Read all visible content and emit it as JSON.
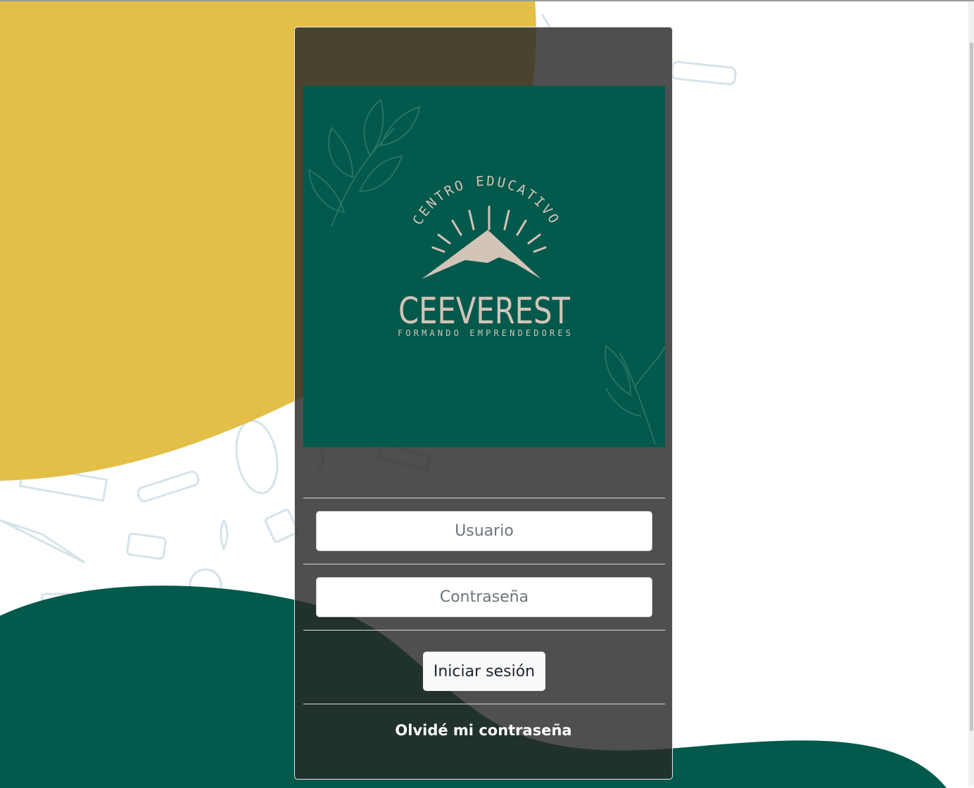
{
  "colors": {
    "yellow": "#e3bf48",
    "green": "#02594c",
    "logo_beige": "#d3c4b8",
    "panel": "#3c3c3c"
  },
  "logo": {
    "top_text": "CENTRO EDUCATIVO",
    "name": "CEEVEREST",
    "tagline": "FORMANDO EMPRENDEDORES"
  },
  "form": {
    "username_placeholder": "Usuario",
    "password_placeholder": "Contraseña",
    "login_label": "Iniciar sesión",
    "forgot_label": "Olvidé mi contraseña"
  }
}
